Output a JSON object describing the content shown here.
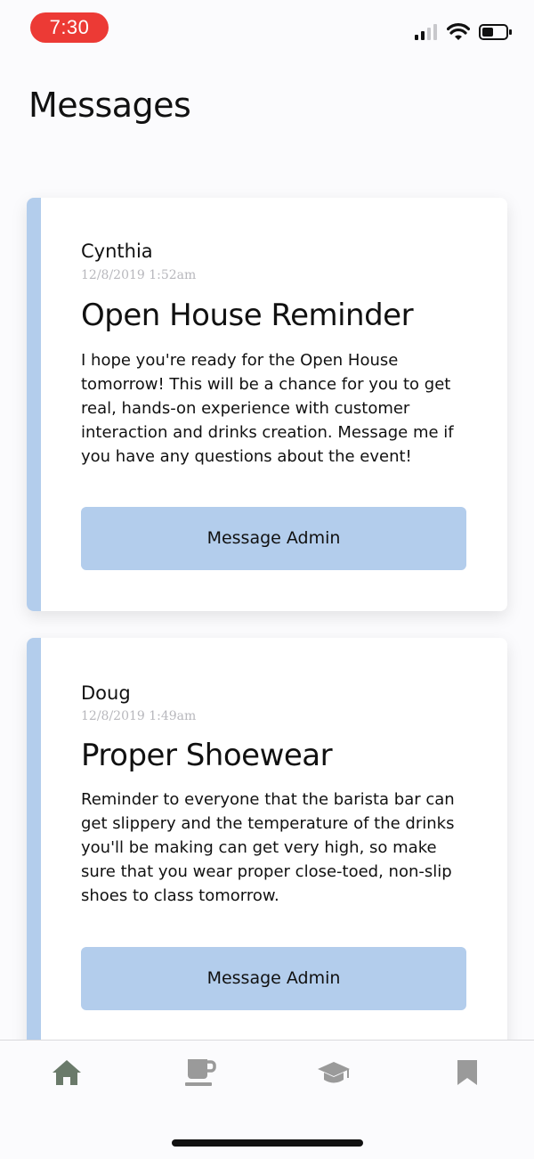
{
  "status_bar": {
    "time": "7:30",
    "icons": [
      "signal-icon",
      "wifi-icon",
      "battery-icon"
    ],
    "time_pill_color": "#ec3a35"
  },
  "page": {
    "title": "Messages"
  },
  "messages": [
    {
      "sender": "Cynthia",
      "timestamp": "12/8/2019 1:52am",
      "title": "Open House Reminder",
      "body": "I hope you're ready for the Open House tomorrow! This will be a chance for you to get real, hands-on experience with customer interaction and drinks creation. Message me if you have any questions about the event!",
      "button_label": "Message Admin"
    },
    {
      "sender": "Doug",
      "timestamp": "12/8/2019 1:49am",
      "title": "Proper Shoewear",
      "body": "Reminder to everyone that the barista bar can get slippery and the temperature of the drinks you'll be making can get very high, so make sure that you wear proper close-toed, non-slip shoes to class tomorrow.",
      "button_label": "Message Admin"
    }
  ],
  "tab_bar": {
    "tabs": [
      {
        "icon": "home-icon",
        "active": true
      },
      {
        "icon": "coffee-cup-icon",
        "active": false
      },
      {
        "icon": "graduation-cap-icon",
        "active": false
      },
      {
        "icon": "bookmark-icon",
        "active": false
      }
    ],
    "active_color": "#6a7a6a",
    "inactive_color": "#9a9a9a"
  },
  "colors": {
    "accent": "#b3cdec",
    "background": "#fbfbfd"
  }
}
